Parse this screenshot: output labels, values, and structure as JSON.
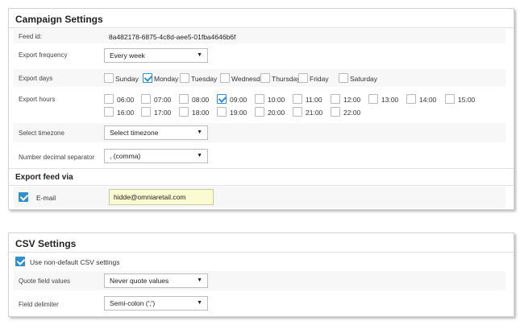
{
  "campaign": {
    "title": "Campaign Settings",
    "feed_id_label": "Feed id:",
    "feed_id_value": "8a482178-6875-4c8d-aee5-01fba4646b6f",
    "export_frequency_label": "Export frequency",
    "export_frequency_value": "Every week",
    "export_days_label": "Export days",
    "days": [
      {
        "label": "Sunday",
        "checked": false
      },
      {
        "label": "Monday",
        "checked": true
      },
      {
        "label": "Tuesday",
        "checked": false
      },
      {
        "label": "Wednesday",
        "checked": false
      },
      {
        "label": "Thursday",
        "checked": false
      },
      {
        "label": "Friday",
        "checked": false
      },
      {
        "label": "Saturday",
        "checked": false
      }
    ],
    "export_hours_label": "Export hours",
    "hours_row1": [
      {
        "label": "06:00",
        "checked": false
      },
      {
        "label": "07:00",
        "checked": false
      },
      {
        "label": "08:00",
        "checked": false
      },
      {
        "label": "09:00",
        "checked": true
      },
      {
        "label": "10:00",
        "checked": false
      },
      {
        "label": "11:00",
        "checked": false
      },
      {
        "label": "12:00",
        "checked": false
      },
      {
        "label": "13:00",
        "checked": false
      },
      {
        "label": "14:00",
        "checked": false
      },
      {
        "label": "15:00",
        "checked": false
      }
    ],
    "hours_row2": [
      {
        "label": "16:00",
        "checked": false
      },
      {
        "label": "17:00",
        "checked": false
      },
      {
        "label": "18:00",
        "checked": false
      },
      {
        "label": "19:00",
        "checked": false
      },
      {
        "label": "20:00",
        "checked": false
      },
      {
        "label": "21:00",
        "checked": false
      },
      {
        "label": "22:00",
        "checked": false
      }
    ],
    "timezone_label": "Select timezone",
    "timezone_value": "Select timezone",
    "decimal_label": "Number decimal separator",
    "decimal_value": ", (comma)",
    "export_via_title": "Export feed via",
    "email_label": "E-mail",
    "email_checked": true,
    "email_value": "hidde@omniaretail.com"
  },
  "csv": {
    "title": "CSV Settings",
    "non_default_label": "Use non-default CSV settings",
    "non_default_checked": true,
    "quote_label": "Quote field values",
    "quote_value": "Never quote values",
    "delimiter_label": "Field delimiter",
    "delimiter_value": "Semi-colon (';')"
  },
  "colors": {
    "checkbox_accent": "#2f8fcf",
    "email_input_bg": "#fbfbd2",
    "row_shade": "#f7f7f7"
  },
  "icons": {
    "dropdown_arrow": "triangle-down-icon",
    "checkmark": "checkmark-icon"
  }
}
